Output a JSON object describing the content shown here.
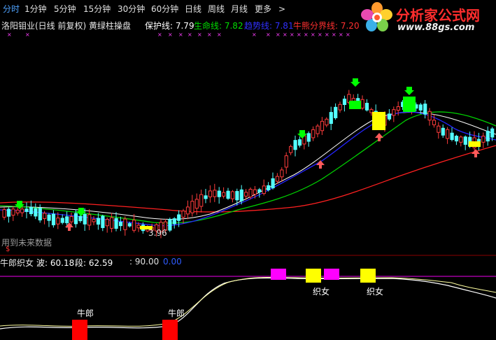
{
  "toolbar": {
    "tabs": [
      {
        "label": "分时"
      },
      {
        "label": "1分钟"
      },
      {
        "label": "5分钟"
      },
      {
        "label": "15分钟"
      },
      {
        "label": "30分钟"
      },
      {
        "label": "60分钟"
      },
      {
        "label": "日线"
      },
      {
        "label": "周线"
      },
      {
        "label": "月线"
      },
      {
        "label": "更多"
      }
    ],
    "more_arrow": ">"
  },
  "logo": {
    "title": "分析家公式网",
    "url": "www.88gs.com",
    "icon": "flower-logo-icon"
  },
  "info": {
    "security": "洛阳钼业(日线 前复权) 黄绿柱操盘",
    "protect": "保护线: 7.79",
    "life": "生命线: 7.82",
    "trend": "趋势线: 7.81",
    "split": "牛熊分界线: 7.20"
  },
  "main_chart": {
    "price_label": "3.96",
    "future_data": "用到未来数据",
    "dollar_mark": "$"
  },
  "sub_chart": {
    "name": "牛郎织女",
    "wave": "波: 60.18",
    "segment": "段: 62.59",
    "level": ": 90.00",
    "zero": "0.00",
    "labels": {
      "niulang": "牛郎",
      "zhinv": "织女"
    }
  },
  "colors": {
    "up": "#ff3c3c",
    "down": "#54ffff",
    "protect": "#ff3030",
    "life": "#00dd00",
    "trend": "#2828ff",
    "split": "#ff2828",
    "yellow_bar": "#ffff00",
    "green_bar": "#00ff00",
    "magenta": "#ff00ff",
    "red_block": "#ff0000"
  },
  "chart_data": {
    "type": "candlestick",
    "indicator_lines": [
      "保护线",
      "生命线",
      "趋势线",
      "牛熊分界线"
    ],
    "subchart_series": [
      "波",
      "段"
    ]
  }
}
